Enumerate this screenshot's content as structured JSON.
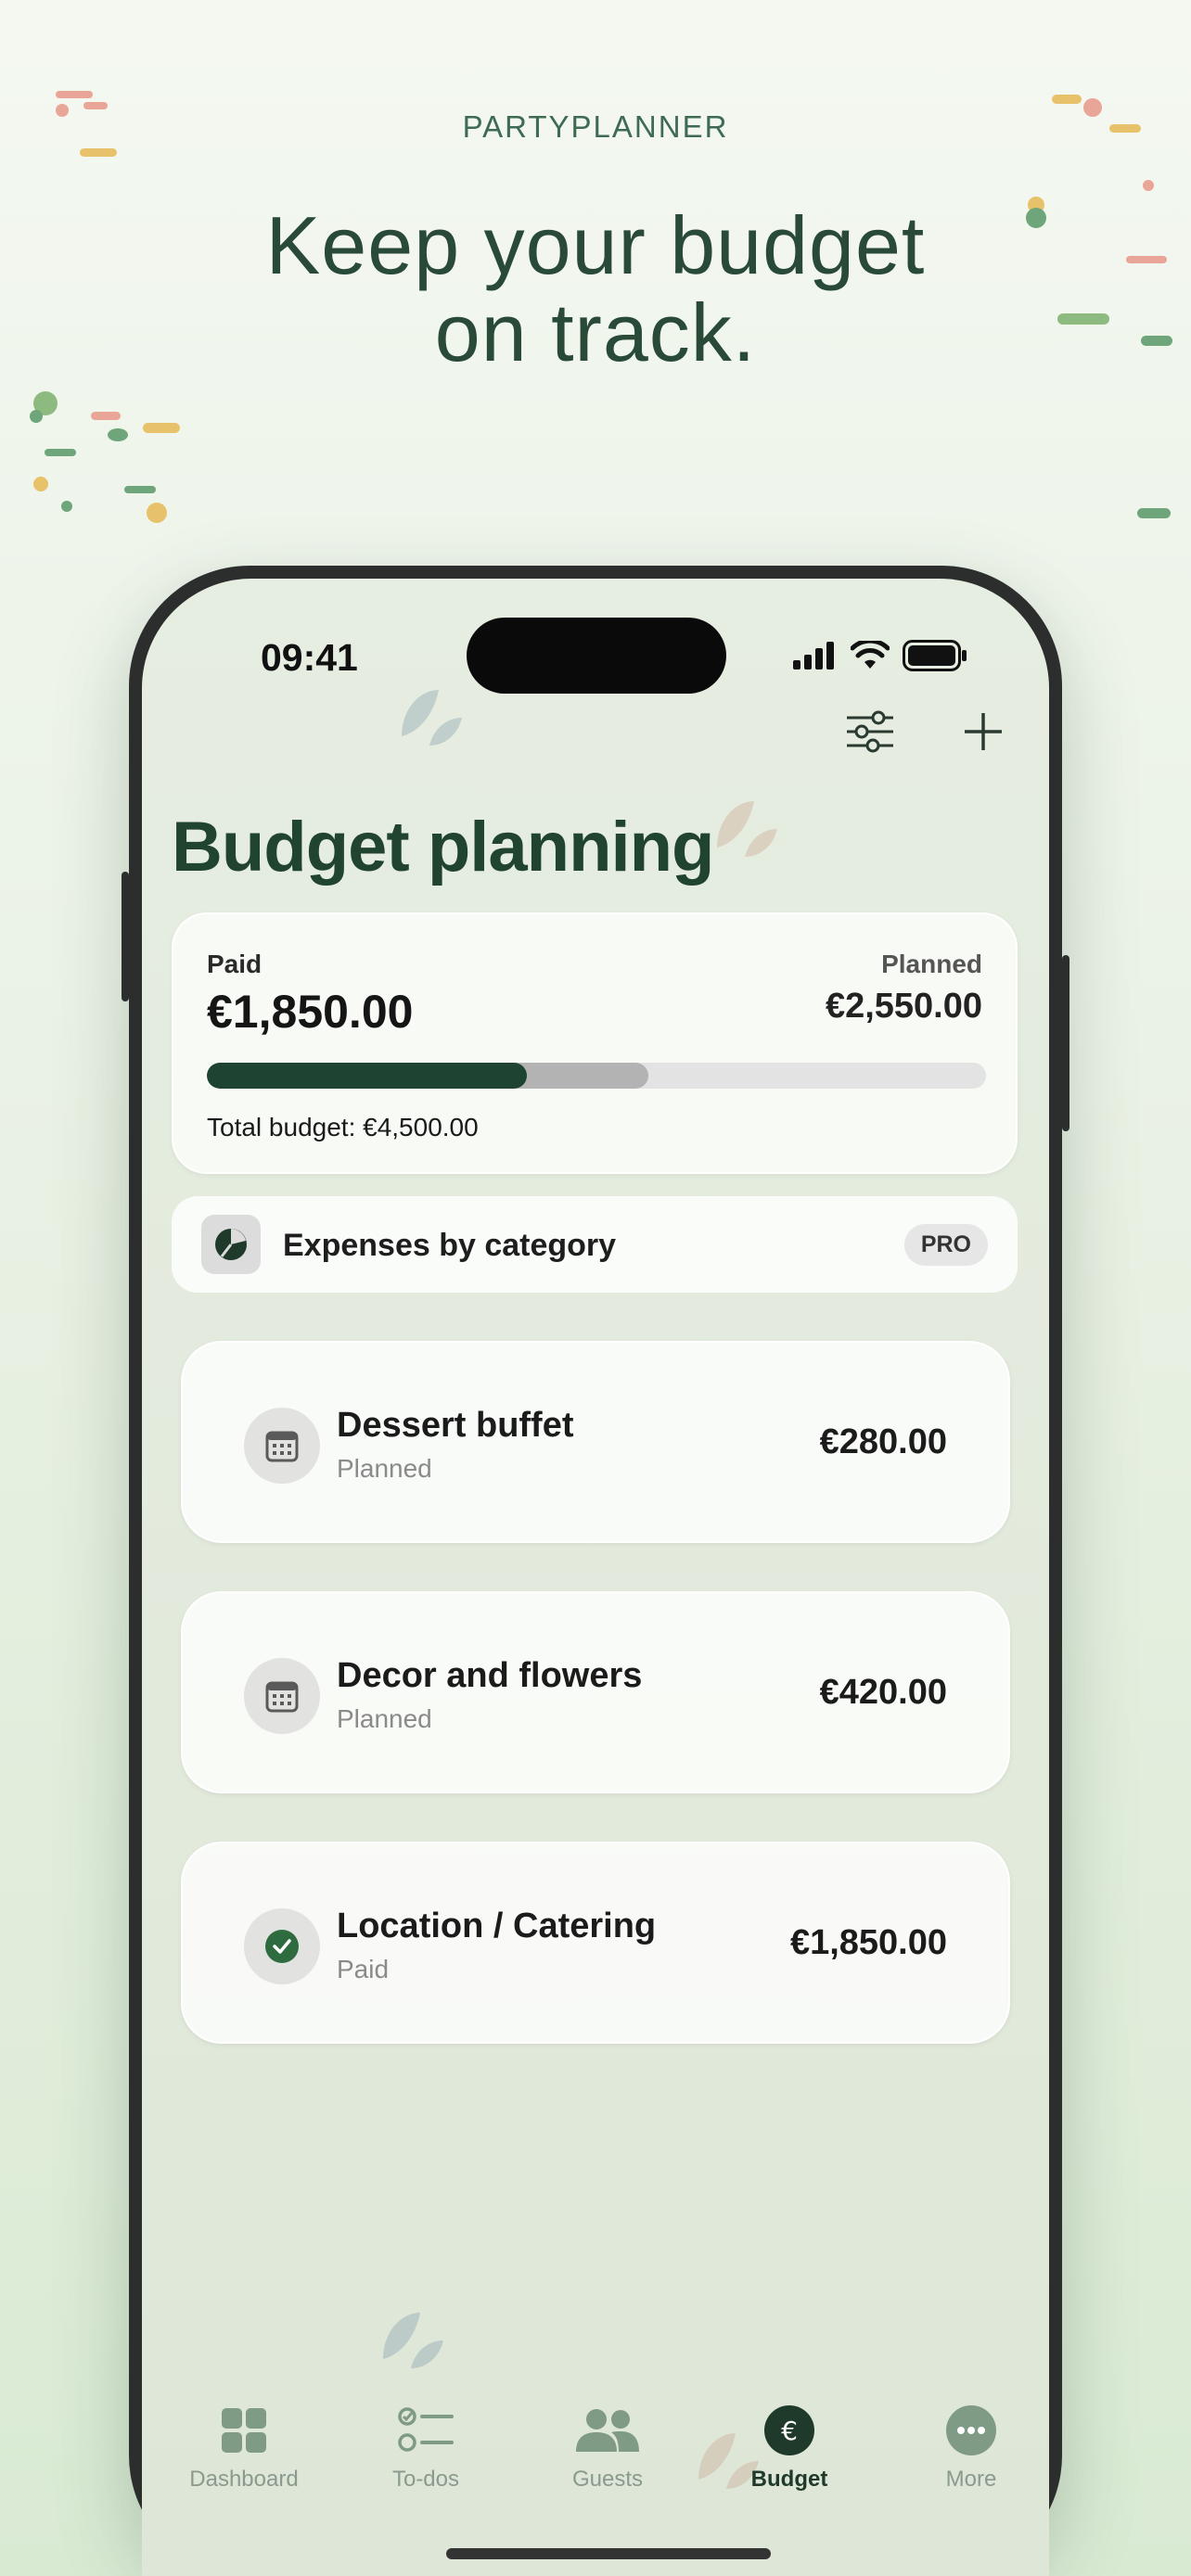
{
  "marketing": {
    "brand": "PARTYPLANNER",
    "headline_line1": "Keep your budget",
    "headline_line2": "on track."
  },
  "status_bar": {
    "time": "09:41",
    "icons": [
      "cellular-signal-icon",
      "wifi-icon",
      "battery-icon"
    ]
  },
  "toolbar": {
    "icons": [
      "sliders-icon",
      "plus-icon"
    ]
  },
  "page": {
    "title": "Budget planning"
  },
  "summary": {
    "paid_label": "Paid",
    "paid_value": "€1,850.00",
    "planned_label": "Planned",
    "planned_value": "€2,550.00",
    "total_budget": "Total budget: €4,500.00",
    "paid_fraction": 0.411,
    "planned_fraction": 0.567
  },
  "category_row": {
    "label": "Expenses by category",
    "badge": "PRO",
    "icon": "pie-chart-icon"
  },
  "expenses": [
    {
      "name": "Dessert buffet",
      "status": "Planned",
      "amount": "€280.00",
      "icon": "calendar-icon"
    },
    {
      "name": "Decor and flowers",
      "status": "Planned",
      "amount": "€420.00",
      "icon": "calendar-icon"
    },
    {
      "name": "Location / Catering",
      "status": "Paid",
      "amount": "€1,850.00",
      "icon": "check-circle-icon"
    }
  ],
  "tabs": [
    {
      "label": "Dashboard",
      "icon": "grid-icon",
      "active": false
    },
    {
      "label": "To-dos",
      "icon": "checklist-icon",
      "active": false
    },
    {
      "label": "Guests",
      "icon": "people-icon",
      "active": false
    },
    {
      "label": "Budget",
      "icon": "euro-icon",
      "active": true
    },
    {
      "label": "More",
      "icon": "more-icon",
      "active": false
    }
  ],
  "colors": {
    "accent_dark_green": "#1f4332",
    "headline_green": "#284a37",
    "paid_check_green": "#2e6b3e",
    "confetti_pink": "#e8a598",
    "confetti_yellow": "#e8c26a",
    "confetti_green": "#6fa57a"
  }
}
